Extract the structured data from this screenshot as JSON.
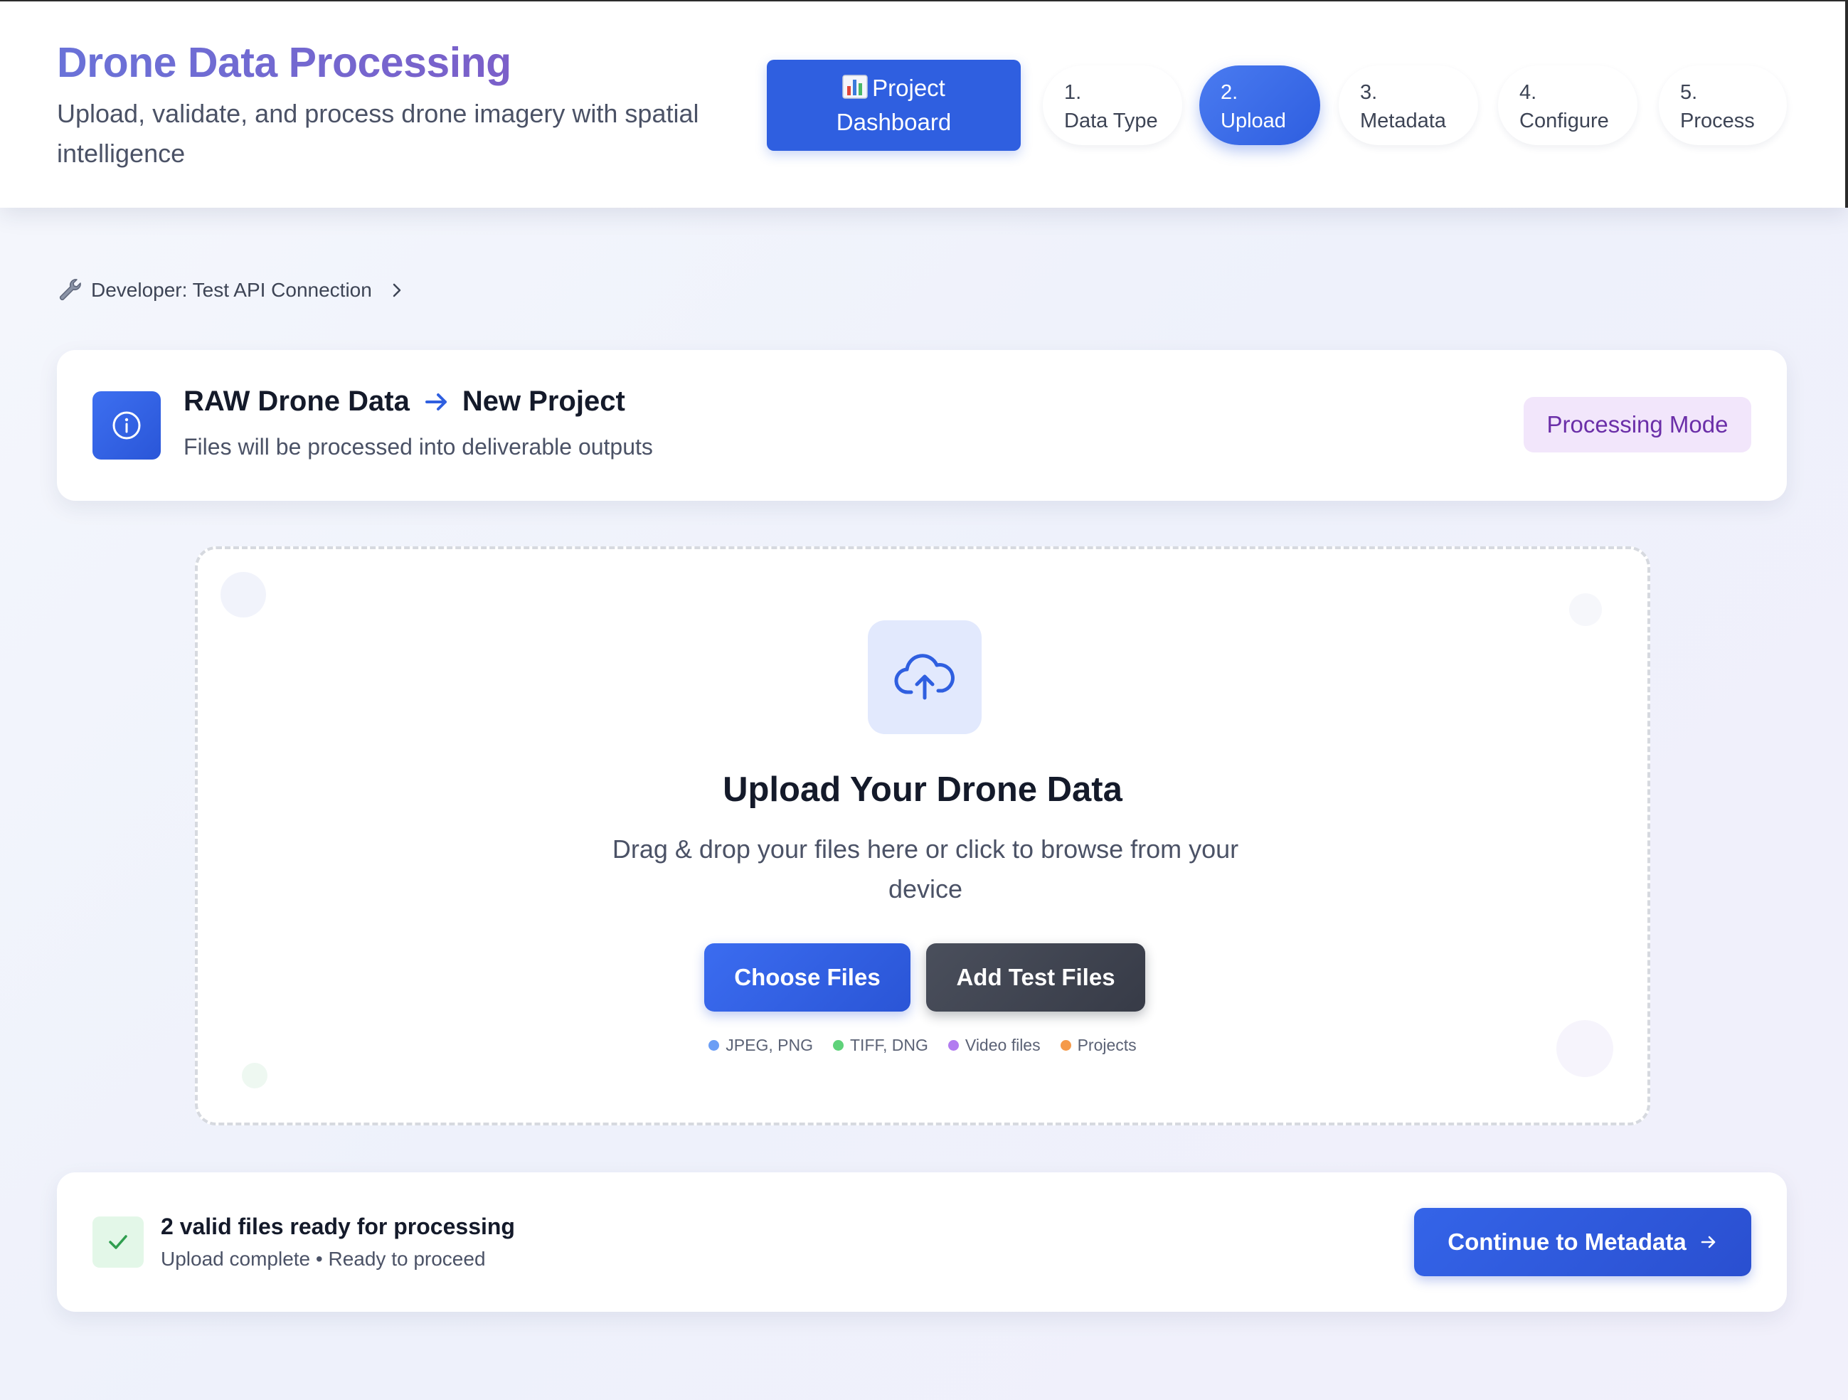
{
  "header": {
    "title": "Drone Data Processing",
    "subtitle": "Upload, validate, and process drone imagery with spatial intelligence",
    "dashboard_button": "Project Dashboard",
    "steps": [
      {
        "num": "1.",
        "label": "Data Type",
        "active": false
      },
      {
        "num": "2.",
        "label": "Upload",
        "active": true
      },
      {
        "num": "3.",
        "label": "Metadata",
        "active": false
      },
      {
        "num": "4.",
        "label": "Configure",
        "active": false
      },
      {
        "num": "5.",
        "label": "Process",
        "active": false
      }
    ]
  },
  "dev_link": {
    "label": "Developer: Test API Connection",
    "icon": "wrench-icon"
  },
  "info_card": {
    "source": "RAW Drone Data",
    "target": "New Project",
    "description": "Files will be processed into deliverable outputs",
    "badge": "Processing Mode",
    "icon": "info-icon"
  },
  "upload": {
    "title": "Upload Your Drone Data",
    "description": "Drag & drop your files here or click to browse from your device",
    "choose_button": "Choose Files",
    "test_button": "Add Test Files",
    "formats": [
      {
        "label": "JPEG, PNG",
        "color": "#6b9ef5"
      },
      {
        "label": "TIFF, DNG",
        "color": "#5fd27a"
      },
      {
        "label": "Video files",
        "color": "#b27cf0"
      },
      {
        "label": "Projects",
        "color": "#f59a4a"
      }
    ],
    "icon": "cloud-upload-icon"
  },
  "status": {
    "title": "2 valid files ready for processing",
    "subtitle": "Upload complete • Ready to proceed",
    "continue_button": "Continue to Metadata",
    "icon": "check-icon"
  },
  "colors": {
    "accent": "#2f5fe0",
    "badge_bg": "#f2e6fb",
    "badge_text": "#6b2fa8",
    "success_bg": "#e3f7e8",
    "success": "#2f9e4f"
  }
}
